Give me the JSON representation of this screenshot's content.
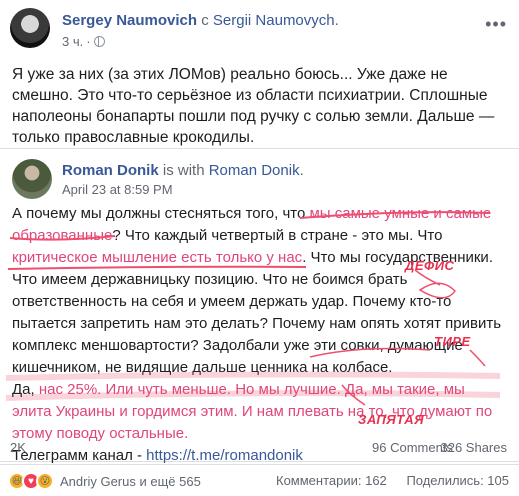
{
  "outer_post": {
    "author": "Sergey Naumovich",
    "connector": " с ",
    "tagged": "Sergii Naumovych",
    "tagged_suffix": ".",
    "time": "3 ч.",
    "text": "Я уже за них (за этих ЛОМов) реально боюсь... Уже даже не смешно. Это что-то серьёзное из области психиатрии. Сплошные наполеоны бонапарты пошли под ручку с солью земли. Дальше — только православные крокодилы."
  },
  "shared_post": {
    "author": "Roman Donik",
    "connector": " is with ",
    "tagged": "Roman Donik",
    "tagged_suffix": ".",
    "time": "April 23 at 8:59 PM",
    "text": {
      "p1_a": "А почему мы должны стесняться того, что ",
      "p1_hl1": "мы самые умные и самые образованные",
      "p1_b": "? Что каждый четвертый в стране - это мы. Что ",
      "p1_hl2": "критическое мышление есть только у нас",
      "p1_c": ". Что мы государственники. Что имеем державницьку позицию. Что не боимся брать ответственность на себя и умеем держать удар. Почему кто-то пытается запретить нам это делать? Почему нам опять хотят привить комплекс меншовартости? Задолбали уже эти совки, думающие кишечником, не видящие дальше ценника на колбасе.",
      "p2_a": "Да, ",
      "p2_hl1": "нас 25%. Или чуть меньше. Но мы лучшие. Да, мы такие, мы элита Украины и гордимся этим. И нам плевать на то, что думают по этому поводу остальные.",
      "p3_a": "Телеграмм канал - ",
      "p3_link": "https://t.me/romandonik"
    },
    "annotations": {
      "defis": "ДЕФИС",
      "tire": "ТИРЕ",
      "zapyataya": "ЗАПЯТАЯ"
    },
    "reactions_count": "2K",
    "comments": "96 Comments",
    "shares": "326 Shares"
  },
  "footer": {
    "reacted_by": "Andriy Gerus и ещё 565",
    "comments_total": "Комментарии: 162",
    "shares_total": "Поделились: 105"
  },
  "icons": [
    "globe-icon",
    "more-icon",
    "haha-reaction-icon",
    "love-reaction-icon",
    "wow-reaction-icon"
  ],
  "colors": {
    "link": "#385898",
    "annotation": "#e8304f",
    "highlight": "#e0467a"
  }
}
